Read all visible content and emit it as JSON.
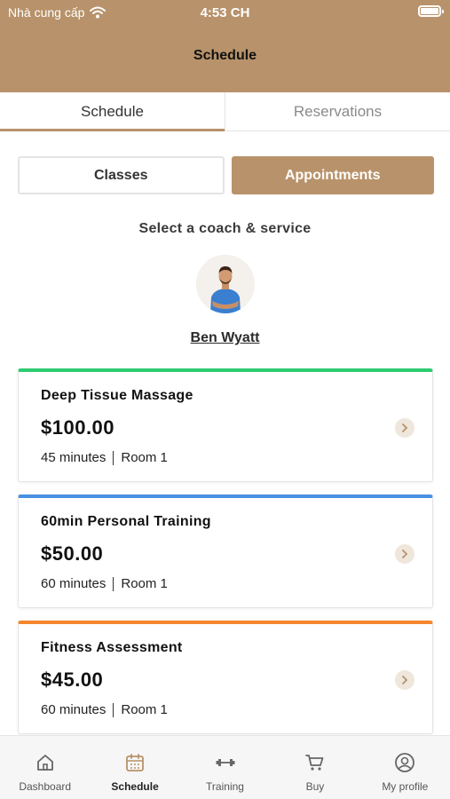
{
  "status_bar": {
    "carrier": "Nhà cung cấp",
    "time": "4:53 CH"
  },
  "header": {
    "title": "Schedule"
  },
  "top_tabs": [
    {
      "label": "Schedule",
      "active": true
    },
    {
      "label": "Reservations",
      "active": false
    }
  ],
  "segment": {
    "classes": "Classes",
    "appointments": "Appointments",
    "selected": "Appointments"
  },
  "prompt": "Select a coach & service",
  "coach": {
    "name": "Ben Wyatt"
  },
  "services": [
    {
      "name": "Deep Tissue Massage",
      "price": "$100.00",
      "duration": "45 minutes",
      "room": "Room 1",
      "accent": "#2ecc71"
    },
    {
      "name": "60min Personal Training",
      "price": "$50.00",
      "duration": "60 minutes",
      "room": "Room 1",
      "accent": "#4a90e2"
    },
    {
      "name": "Fitness Assessment",
      "price": "$45.00",
      "duration": "60 minutes",
      "room": "Room 1",
      "accent": "#f5872d"
    }
  ],
  "bottom_nav": [
    {
      "label": "Dashboard",
      "icon": "home-icon"
    },
    {
      "label": "Schedule",
      "icon": "calendar-icon",
      "active": true
    },
    {
      "label": "Training",
      "icon": "dumbbell-icon"
    },
    {
      "label": "Buy",
      "icon": "cart-icon"
    },
    {
      "label": "My profile",
      "icon": "profile-icon"
    }
  ],
  "colors": {
    "brand": "#b8926a",
    "brand_light": "#efe6dc"
  }
}
